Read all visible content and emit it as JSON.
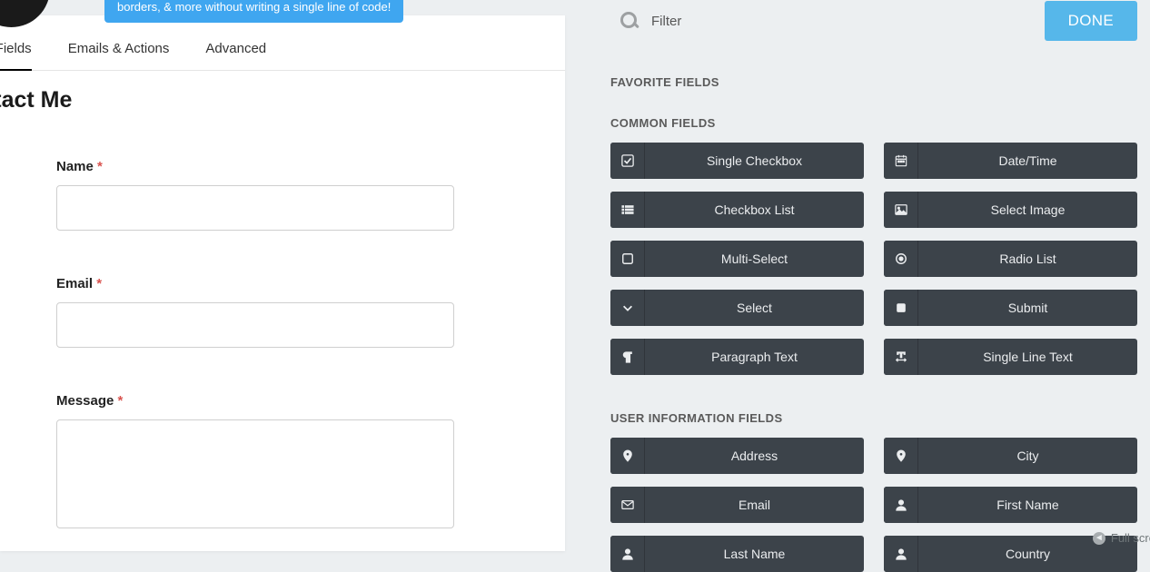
{
  "banner_text": "borders, & more without writing a single line of code!",
  "tabs": {
    "form_fields": "m Fields",
    "emails_actions": "Emails & Actions",
    "advanced": "Advanced"
  },
  "form": {
    "title": "ntact Me",
    "name_label": "Name",
    "email_label": "Email",
    "message_label": "Message",
    "required_mark": "*"
  },
  "filter": {
    "placeholder": "Filter",
    "done": "DONE"
  },
  "sections": {
    "favorite": "FAVORITE FIELDS",
    "common": "COMMON FIELDS",
    "user_info": "USER INFORMATION FIELDS"
  },
  "common_fields": [
    {
      "label": "Single Checkbox",
      "icon": "check-square"
    },
    {
      "label": "Date/Time",
      "icon": "calendar"
    },
    {
      "label": "Checkbox List",
      "icon": "list"
    },
    {
      "label": "Select Image",
      "icon": "image"
    },
    {
      "label": "Multi-Select",
      "icon": "square"
    },
    {
      "label": "Radio List",
      "icon": "dot-circle"
    },
    {
      "label": "Select",
      "icon": "chevron-down"
    },
    {
      "label": "Submit",
      "icon": "square-solid"
    },
    {
      "label": "Paragraph Text",
      "icon": "paragraph"
    },
    {
      "label": "Single Line Text",
      "icon": "text-width"
    }
  ],
  "user_fields": [
    {
      "label": "Address",
      "icon": "map-marker"
    },
    {
      "label": "City",
      "icon": "map-marker"
    },
    {
      "label": "Email",
      "icon": "envelope"
    },
    {
      "label": "First Name",
      "icon": "user"
    },
    {
      "label": "Last Name",
      "icon": "user"
    },
    {
      "label": "Country",
      "icon": "user"
    }
  ],
  "fullscreen": "Full scre"
}
